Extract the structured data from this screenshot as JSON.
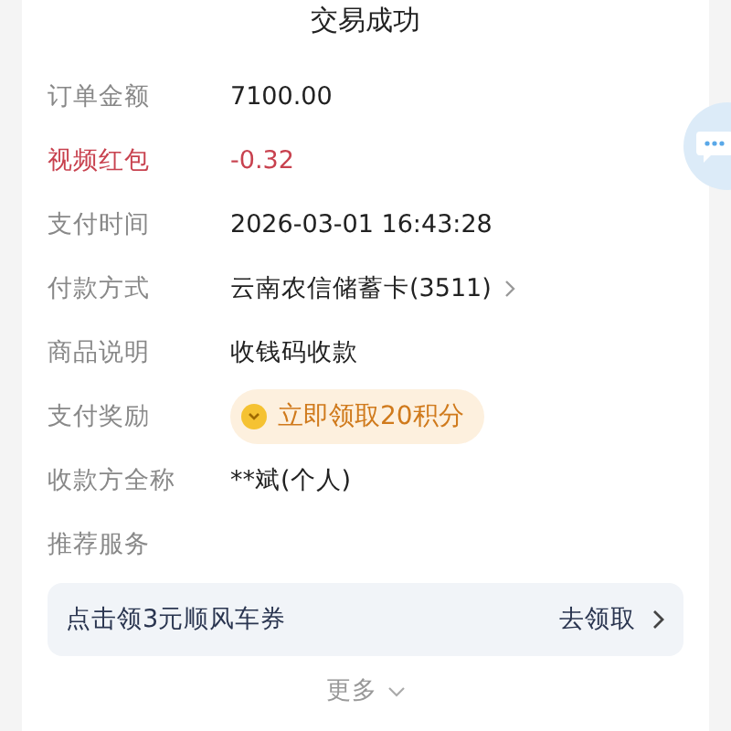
{
  "title": "交易成功",
  "rows": [
    {
      "kind": "plain",
      "label": "订单金额",
      "value": "7100.00"
    },
    {
      "kind": "discount",
      "label": "视频红包",
      "value": "-0.32"
    },
    {
      "kind": "plain",
      "label": "支付时间",
      "value": "2026-03-01 16:43:28"
    },
    {
      "kind": "link",
      "label": "付款方式",
      "value": "云南农信储蓄卡(3511)"
    },
    {
      "kind": "plain",
      "label": "商品说明",
      "value": "收钱码收款"
    },
    {
      "kind": "reward",
      "label": "支付奖励",
      "value": "立即领取20积分"
    },
    {
      "kind": "plain",
      "label": "收款方全称",
      "value": "**斌(个人)"
    }
  ],
  "recommend": {
    "label": "推荐服务",
    "banner_text": "点击领3元顺风车券",
    "banner_action": "去领取"
  },
  "more": "更多"
}
